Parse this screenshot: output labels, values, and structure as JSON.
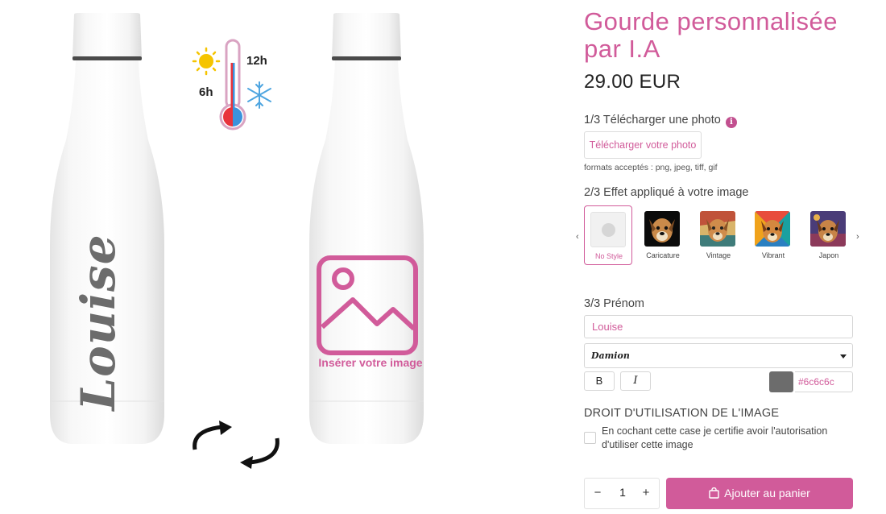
{
  "product": {
    "title": "Gourde personnalisée par I.A",
    "price": "29.00 EUR",
    "bottle_name_text": "Louise",
    "image_placeholder_label": "Insérer votre image",
    "thermo": {
      "hot_label": "12h",
      "cold_label": "6h"
    }
  },
  "step1": {
    "label": "1/3 Télécharger une photo",
    "info_icon": "i",
    "upload_button": "Télécharger votre photo",
    "formats_note": "formats acceptés : png, jpeg, tiff, gif"
  },
  "step2": {
    "label": "2/3 Effet appliqué à votre image",
    "prev_arrow": "‹",
    "next_arrow": "›",
    "styles": [
      {
        "name": "No Style",
        "selected": true
      },
      {
        "name": "Caricature",
        "selected": false
      },
      {
        "name": "Vintage",
        "selected": false
      },
      {
        "name": "Vibrant",
        "selected": false
      },
      {
        "name": "Japon",
        "selected": false
      }
    ]
  },
  "step3": {
    "label": "3/3 Prénom",
    "name_value": "Louise",
    "font_value": "Damion",
    "bold_label": "B",
    "italic_label": "I",
    "color_value": "#6c6c6c"
  },
  "rights": {
    "title": "DROIT D'UTILISATION DE L'IMAGE",
    "checkbox_text": "En cochant cette case je certifie avoir l'autorisation d'utiliser cette image",
    "checked": false
  },
  "purchase": {
    "minus": "−",
    "plus": "+",
    "quantity": "1",
    "add_to_cart": "Ajouter au panier"
  },
  "colors": {
    "accent": "#d15b9a",
    "text_color_swatch": "#6c6c6c"
  },
  "icons": [
    "sun-icon",
    "thermometer-icon",
    "snowflake-icon",
    "rotate-arrows-icon",
    "image-placeholder-icon",
    "info-icon",
    "shopping-bag-icon"
  ]
}
